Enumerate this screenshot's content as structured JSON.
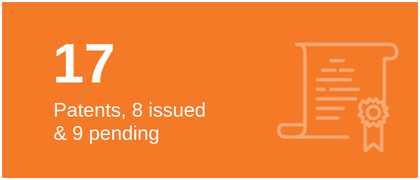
{
  "stat": {
    "number": "17",
    "caption_line1": "Patents, 8 issued",
    "caption_line2": "& 9 pending"
  },
  "icon": {
    "name": "certificate-icon",
    "color": "#f9a874"
  },
  "colors": {
    "card_background": "#f47a28",
    "text": "#ffffff"
  }
}
